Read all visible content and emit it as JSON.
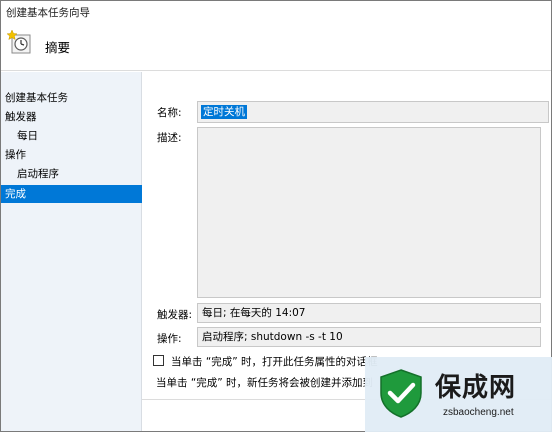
{
  "window": {
    "title": "创建基本任务向导"
  },
  "header": {
    "title": "摘要",
    "icon": "task-clock-icon"
  },
  "sidebar": {
    "items": [
      {
        "label": "创建基本任务",
        "level": "top",
        "selected": false
      },
      {
        "label": "触发器",
        "level": "top",
        "selected": false
      },
      {
        "label": "每日",
        "level": "sub",
        "selected": false
      },
      {
        "label": "操作",
        "level": "top",
        "selected": false
      },
      {
        "label": "启动程序",
        "level": "sub",
        "selected": false
      },
      {
        "label": "完成",
        "level": "top",
        "selected": true
      }
    ]
  },
  "form": {
    "name_label": "名称:",
    "name_value": "定时关机",
    "description_label": "描述:",
    "description_value": "",
    "trigger_label": "触发器:",
    "trigger_value": "每日; 在每天的 14:07",
    "action_label": "操作:",
    "action_value": "启动程序; shutdown -s -t 10"
  },
  "options": {
    "open_properties_label": "当单击 “完成” 时，打开此任务属性的对话框",
    "open_properties_checked": false,
    "note": "当单击 “完成” 时，新任务将会被创建并添加到"
  },
  "watermark": {
    "title": "保成网",
    "url": "zsbaocheng.net"
  },
  "colors": {
    "accent": "#0078d7",
    "sidebar_bg": "#eef3f9",
    "field_bg": "#f0f0f0"
  }
}
